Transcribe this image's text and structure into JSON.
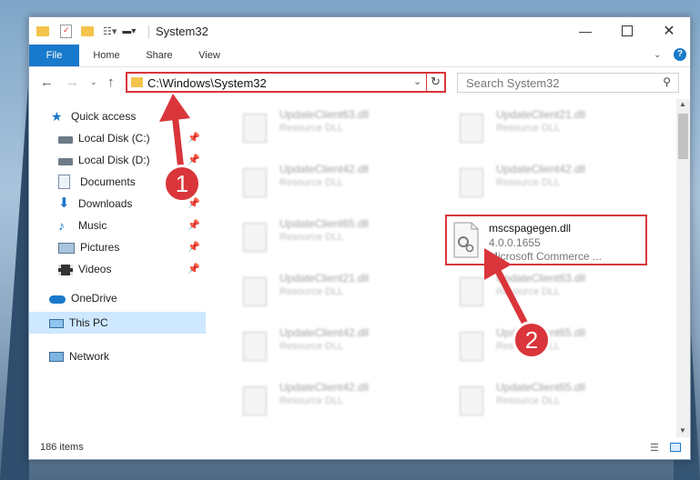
{
  "window": {
    "title": "System32"
  },
  "ribbon": {
    "tabs": [
      "File",
      "Home",
      "Share",
      "View"
    ]
  },
  "address": {
    "path": "C:\\Windows\\System32"
  },
  "search": {
    "placeholder": "Search System32"
  },
  "nav": {
    "items": [
      {
        "label": "Quick access",
        "icon": "star-icon",
        "pinned": false
      },
      {
        "label": "Local Disk (C:)",
        "icon": "drive-icon",
        "pinned": true
      },
      {
        "label": "Local Disk (D:)",
        "icon": "drive-icon",
        "pinned": true
      },
      {
        "label": "Documents",
        "icon": "document-icon",
        "pinned": true
      },
      {
        "label": "Downloads",
        "icon": "download-icon",
        "pinned": true
      },
      {
        "label": "Music",
        "icon": "music-icon",
        "pinned": true
      },
      {
        "label": "Pictures",
        "icon": "pictures-icon",
        "pinned": true
      },
      {
        "label": "Videos",
        "icon": "videos-icon",
        "pinned": true
      },
      {
        "label": "OneDrive",
        "icon": "cloud-icon",
        "pinned": false
      },
      {
        "label": "This PC",
        "icon": "computer-icon",
        "pinned": false,
        "selected": true
      },
      {
        "label": "Network",
        "icon": "network-icon",
        "pinned": false
      }
    ]
  },
  "files": {
    "left": [
      {
        "name": "UpdateClient63.dll",
        "desc": "Resource DLL"
      },
      {
        "name": "UpdateClient42.dll",
        "desc": "Resource DLL"
      },
      {
        "name": "UpdateClient65.dll",
        "desc": "Resource DLL"
      },
      {
        "name": "UpdateClient21.dll",
        "desc": "Resource DLL"
      },
      {
        "name": "UpdateClient42.dll",
        "desc": "Resource DLL"
      },
      {
        "name": "UpdateClient42.dll",
        "desc": "Resource DLL"
      }
    ],
    "right": [
      {
        "name": "UpdateClient21.dll",
        "desc": "Resource DLL"
      },
      {
        "name": "UpdateClient42.dll",
        "desc": "Resource DLL"
      },
      {
        "name": "UpdateClient63.dll",
        "desc": "Resource DLL"
      },
      {
        "name": "UpdateClient65.dll",
        "desc": "Resource DLL"
      },
      {
        "name": "UpdateClient65.dll",
        "desc": "Resource DLL"
      }
    ],
    "selected": {
      "name": "mscspagegen.dll",
      "version": "4.0.0.1655",
      "company": "Microsoft Commerce ..."
    }
  },
  "status": {
    "item_count": "186 items"
  },
  "annotations": {
    "step1": "1",
    "step2": "2",
    "color": "#d9353a"
  }
}
